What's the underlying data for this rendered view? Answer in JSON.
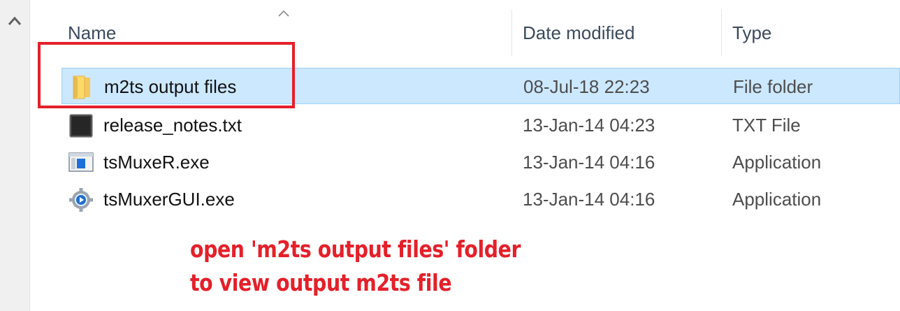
{
  "columns": {
    "name": "Name",
    "date_modified": "Date modified",
    "type": "Type"
  },
  "files": [
    {
      "name": "m2ts output files",
      "date": "08-Jul-18 22:23",
      "type": "File folder",
      "icon": "folder-icon",
      "selected": true
    },
    {
      "name": "release_notes.txt",
      "date": "13-Jan-14 04:23",
      "type": "TXT File",
      "icon": "text-file-icon",
      "selected": false
    },
    {
      "name": "tsMuxeR.exe",
      "date": "13-Jan-14 04:16",
      "type": "Application",
      "icon": "application-window-icon",
      "selected": false
    },
    {
      "name": "tsMuxerGUI.exe",
      "date": "13-Jan-14 04:16",
      "type": "Application",
      "icon": "gear-play-icon",
      "selected": false
    }
  ],
  "annotation": {
    "line1": "open 'm2ts output files' folder",
    "line2": "to view output m2ts file"
  },
  "colors": {
    "selection": "#cce8ff",
    "selection_border": "#99d1ff",
    "annotation_red": "#e4202a",
    "header_text": "#3b4a5c"
  }
}
